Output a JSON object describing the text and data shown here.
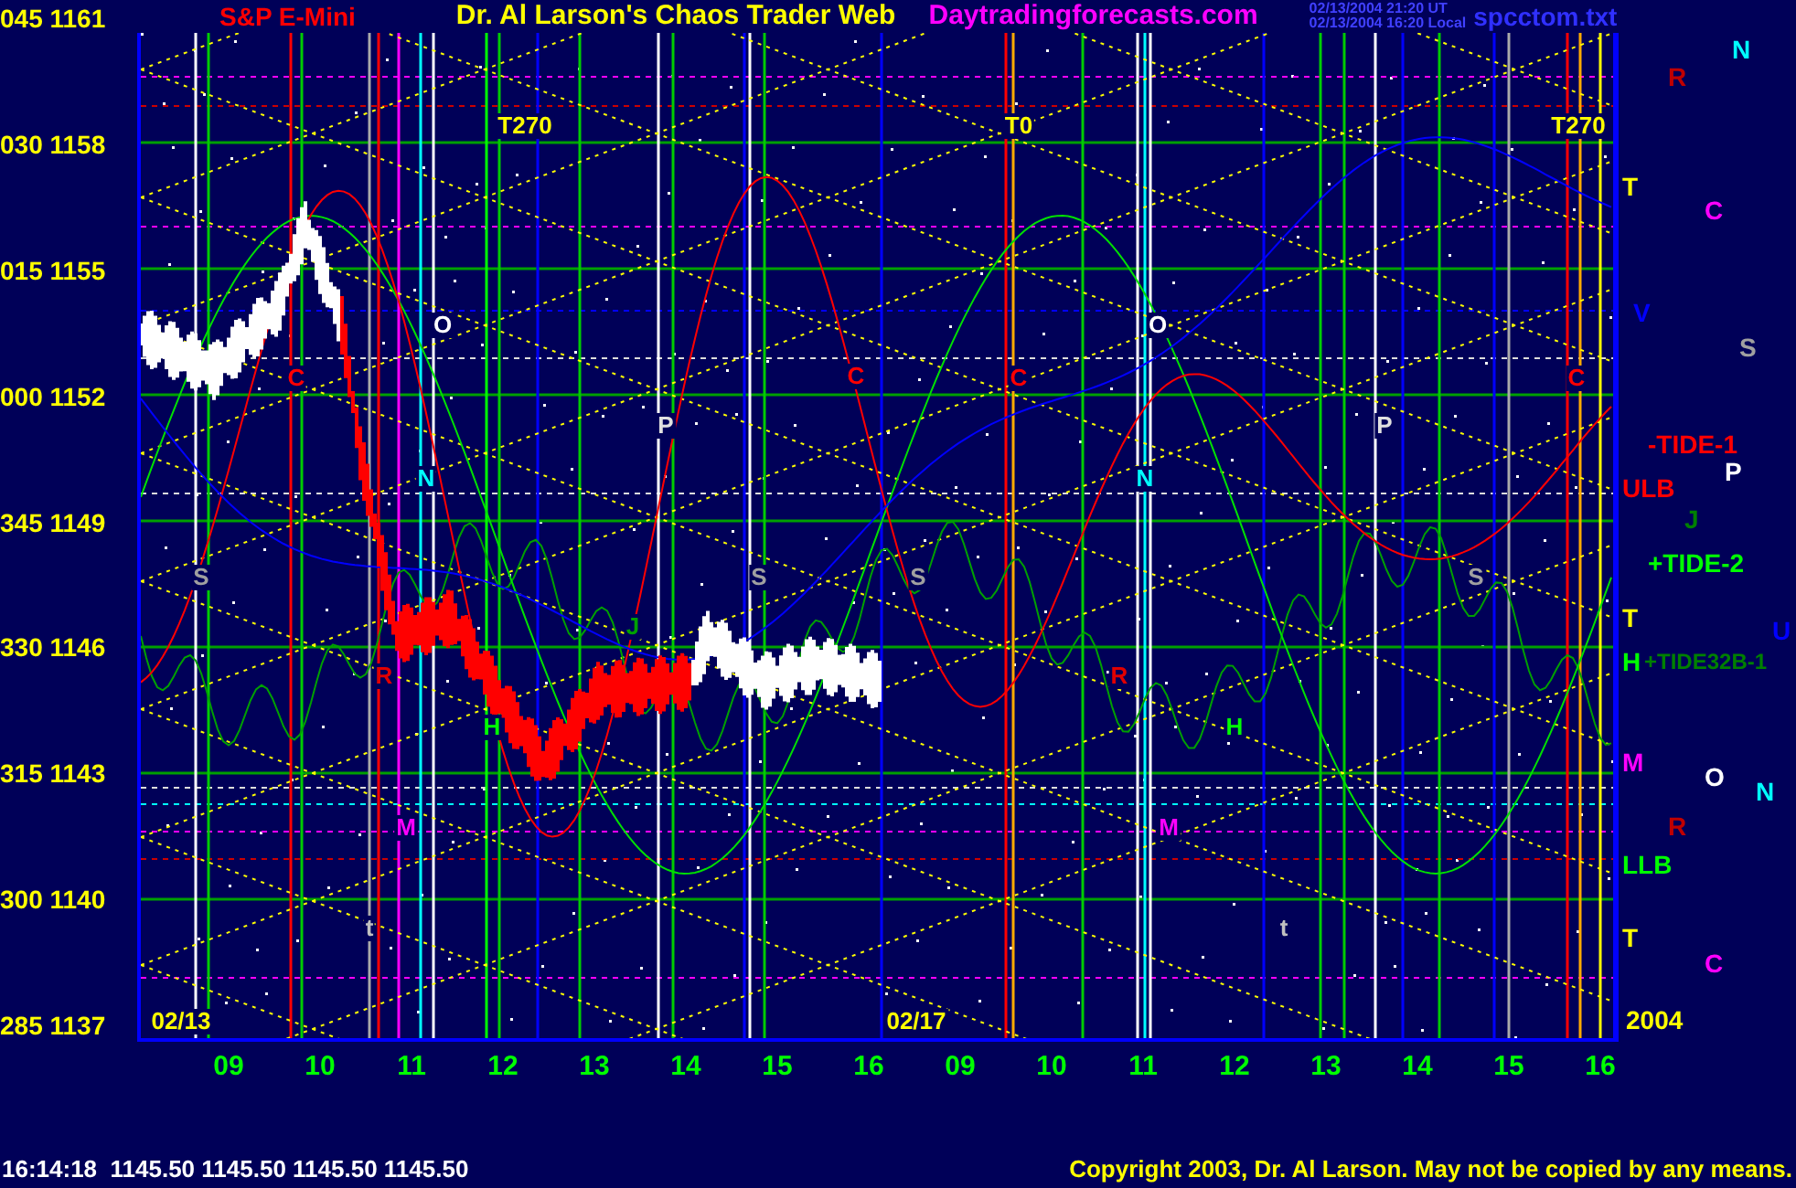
{
  "header": {
    "symbol": "S&P E-Mini",
    "title": "Dr. Al Larson's Chaos Trader Web",
    "site": "Daytradingforecasts.com",
    "timestamps": [
      "02/13/2004 21:20 UT",
      "02/13/2004 16:20 Local"
    ],
    "file": "spcctom.txt"
  },
  "price_axis": [
    "045 1161",
    "030 1158",
    "015 1155",
    "000 1152",
    "345 1149",
    "330 1146",
    "315 1143",
    "300 1140",
    "285 1137"
  ],
  "chart_labels": [
    {
      "text": "T270",
      "color": "#ffff00"
    },
    {
      "text": "T0",
      "color": "#ffff00"
    },
    {
      "text": "T270",
      "color": "#ffff00"
    },
    {
      "text": "O",
      "color": "#ffffff"
    },
    {
      "text": "O",
      "color": "#ffffff"
    },
    {
      "text": "C",
      "color": "#ff0000"
    },
    {
      "text": "C",
      "color": "#ff0000"
    },
    {
      "text": "C",
      "color": "#ff0000"
    },
    {
      "text": "C",
      "color": "#ff0000"
    },
    {
      "text": "P",
      "color": "#e0e0e0"
    },
    {
      "text": "P",
      "color": "#e0e0e0"
    },
    {
      "text": "N",
      "color": "#00ffff"
    },
    {
      "text": "N",
      "color": "#00ffff"
    },
    {
      "text": "S",
      "color": "#a0a0a0"
    },
    {
      "text": "S",
      "color": "#a0a0a0"
    },
    {
      "text": "S",
      "color": "#a0a0a0"
    },
    {
      "text": "S",
      "color": "#a0a0a0"
    },
    {
      "text": "J",
      "color": "#00a000"
    },
    {
      "text": "R",
      "color": "#e00000"
    },
    {
      "text": "R",
      "color": "#e00000"
    },
    {
      "text": "H",
      "color": "#00ff00"
    },
    {
      "text": "H",
      "color": "#00ff00"
    },
    {
      "text": "M",
      "color": "#ff00ff"
    },
    {
      "text": "M",
      "color": "#ff00ff"
    },
    {
      "text": "t",
      "color": "#c0c0c0"
    },
    {
      "text": "t",
      "color": "#c0c0c0"
    },
    {
      "text": "02/13",
      "color": "#ffff00"
    },
    {
      "text": "02/17",
      "color": "#ffff00"
    }
  ],
  "right_labels": [
    {
      "text": "N",
      "color": "#00ffff"
    },
    {
      "text": "R",
      "color": "#c00000"
    },
    {
      "text": "T",
      "color": "#ffff00"
    },
    {
      "text": "C",
      "color": "#ff00ff"
    },
    {
      "text": "V",
      "color": "#0000ff"
    },
    {
      "text": "S",
      "color": "#a0a0a0"
    },
    {
      "text": "-TIDE-1",
      "color": "#ff0000"
    },
    {
      "text": "P",
      "color": "#ffffff"
    },
    {
      "text": "ULB",
      "color": "#ff0000"
    },
    {
      "text": "J",
      "color": "#008000"
    },
    {
      "text": "+TIDE-2",
      "color": "#00ff00"
    },
    {
      "text": "T",
      "color": "#ffff00"
    },
    {
      "text": "U",
      "color": "#0000ff"
    },
    {
      "text": "H",
      "color": "#00ff00"
    },
    {
      "text": "+TIDE32B-1",
      "color": "#008000"
    },
    {
      "text": "M",
      "color": "#ff00ff"
    },
    {
      "text": "O",
      "color": "#ffffff"
    },
    {
      "text": "N",
      "color": "#00ffff"
    },
    {
      "text": "R",
      "color": "#c00000"
    },
    {
      "text": "LLB",
      "color": "#00ff00"
    },
    {
      "text": "T",
      "color": "#ffff00"
    },
    {
      "text": "C",
      "color": "#ff00ff"
    },
    {
      "text": "2004",
      "color": "#ffff00"
    }
  ],
  "hours": [
    "09",
    "10",
    "11",
    "12",
    "13",
    "14",
    "15",
    "16",
    "09",
    "10",
    "11",
    "12",
    "13",
    "14",
    "15",
    "16"
  ],
  "footer": {
    "quote": "16:14:18  1145.50 1145.50 1145.50 1145.50",
    "copyright": "Copyright 2003, Dr. Al Larson. May not be copied by any means."
  }
}
